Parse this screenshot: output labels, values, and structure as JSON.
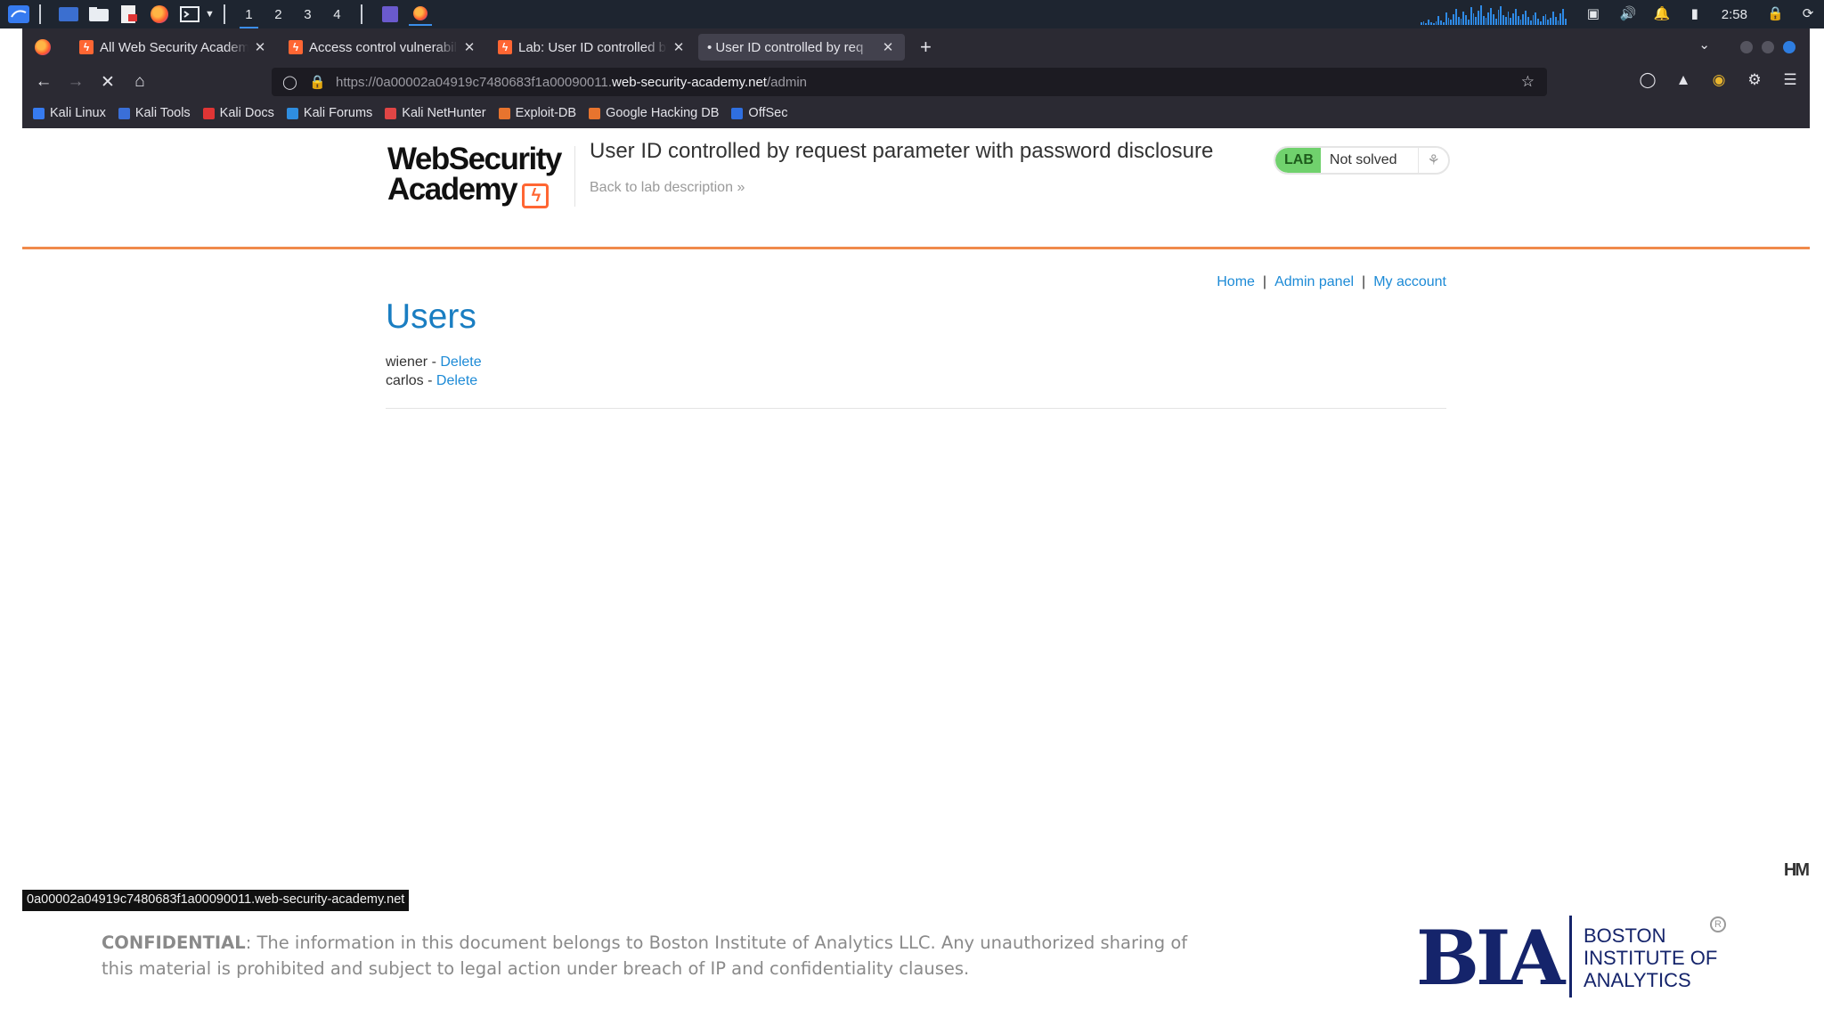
{
  "taskbar": {
    "workspaces": [
      "1",
      "2",
      "3",
      "4"
    ],
    "clock": "2:58",
    "accent_color": "#2e8ae6"
  },
  "browser": {
    "tabs": [
      {
        "label": "All Web Security Academy",
        "active": false
      },
      {
        "label": "Access control vulnerabili",
        "active": false
      },
      {
        "label": "Lab: User ID controlled by",
        "active": false
      },
      {
        "label": "• User ID controlled by req",
        "active": true
      }
    ],
    "url": {
      "prefix": "https://0a00002a04919c7480683f1a00090011.",
      "host": "web-security-academy.net",
      "path": "/admin"
    },
    "bookmarks": [
      {
        "label": "Kali Linux",
        "color": "#367bf0"
      },
      {
        "label": "Kali Tools",
        "color": "#3a6fd8"
      },
      {
        "label": "Kali Docs",
        "color": "#e03535"
      },
      {
        "label": "Kali Forums",
        "color": "#2f8ee0"
      },
      {
        "label": "Kali NetHunter",
        "color": "#e04545"
      },
      {
        "label": "Exploit-DB",
        "color": "#e8742e"
      },
      {
        "label": "Google Hacking DB",
        "color": "#e8742e"
      },
      {
        "label": "OffSec",
        "color": "#2f6fe0"
      }
    ]
  },
  "page": {
    "logo_line1": "WebSecurity",
    "logo_line2": "Academy",
    "lab_title": "User ID controlled by request parameter with password disclosure",
    "back_link": "Back to lab description",
    "lab_badge": "LAB",
    "lab_status": "Not solved",
    "nav": {
      "home": "Home",
      "admin": "Admin panel",
      "account": "My account"
    },
    "users_heading": "Users",
    "users": [
      {
        "name": "wiener",
        "action": "Delete"
      },
      {
        "name": "carlos",
        "action": "Delete"
      }
    ],
    "accent_color": "#f08a4b",
    "link_color": "#1c8ad6"
  },
  "status_bar_url": "0a00002a04919c7480683f1a00090011.web-security-academy.net",
  "footer": {
    "confidential_label": "CONFIDENTIAL",
    "confidential_text": ": The information in this document belongs to Boston Institute of Analytics LLC. Any unauthorized sharing of this material is prohibited and subject to legal action under breach of IP and confidentiality clauses.",
    "bia_mark": "BIA",
    "bia_text": "BOSTON\nINSTITUTE OF\nANALYTICS",
    "bia_color": "#15246b"
  }
}
